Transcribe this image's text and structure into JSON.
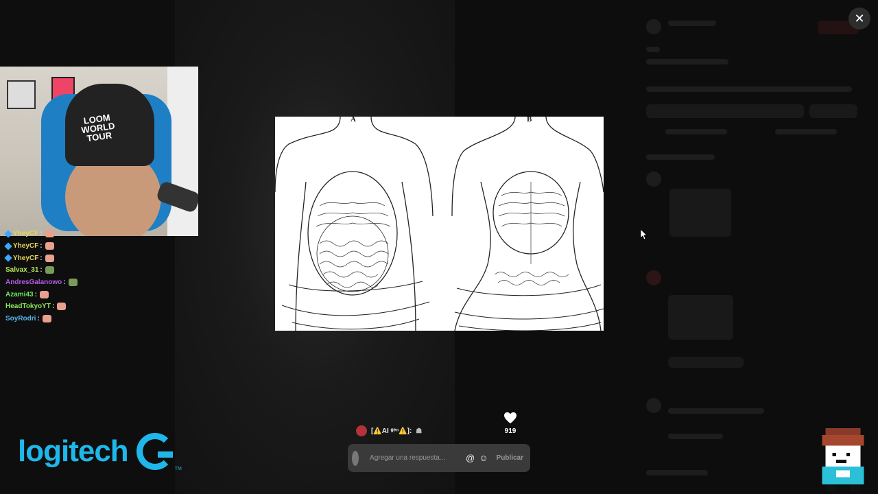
{
  "modal": {
    "close_label": "✕",
    "image_labels": {
      "left": "A",
      "right": "B"
    }
  },
  "chat": {
    "messages": [
      {
        "user": "YheyCF",
        "color": "#e6d85a",
        "has_badge": true
      },
      {
        "user": "YheyCF",
        "color": "#e6d85a",
        "has_badge": true
      },
      {
        "user": "YheyCF",
        "color": "#e6d85a",
        "has_badge": true
      },
      {
        "user": "Salvax_31",
        "color": "#b6e65a",
        "has_badge": false
      },
      {
        "user": "AndresGalanowo",
        "color": "#b65ae6",
        "has_badge": false
      },
      {
        "user": "Azami43",
        "color": "#6be65a",
        "has_badge": false
      },
      {
        "user": "HeadTokyoYT",
        "color": "#8ce65a",
        "has_badge": false
      },
      {
        "user": "SoyRodri",
        "color": "#5ab4e6",
        "has_badge": false
      }
    ],
    "separator": ":"
  },
  "webcam": {
    "cap_text": "LOOM WORLD TOUR"
  },
  "brand": {
    "wordmark": "logitech",
    "trademark": "TM"
  },
  "post": {
    "reply_author": "[⚠️AI ᵍᵉⁿ⚠️]:",
    "like_count": "919",
    "reply_placeholder": "Agregar una respuesta...",
    "publish_label": "Publicar",
    "mention_icon": "@",
    "emoji_icon": "☺"
  },
  "colors": {
    "logitech_blue": "#1fb7ea",
    "reply_box": "#3a3a3a"
  }
}
